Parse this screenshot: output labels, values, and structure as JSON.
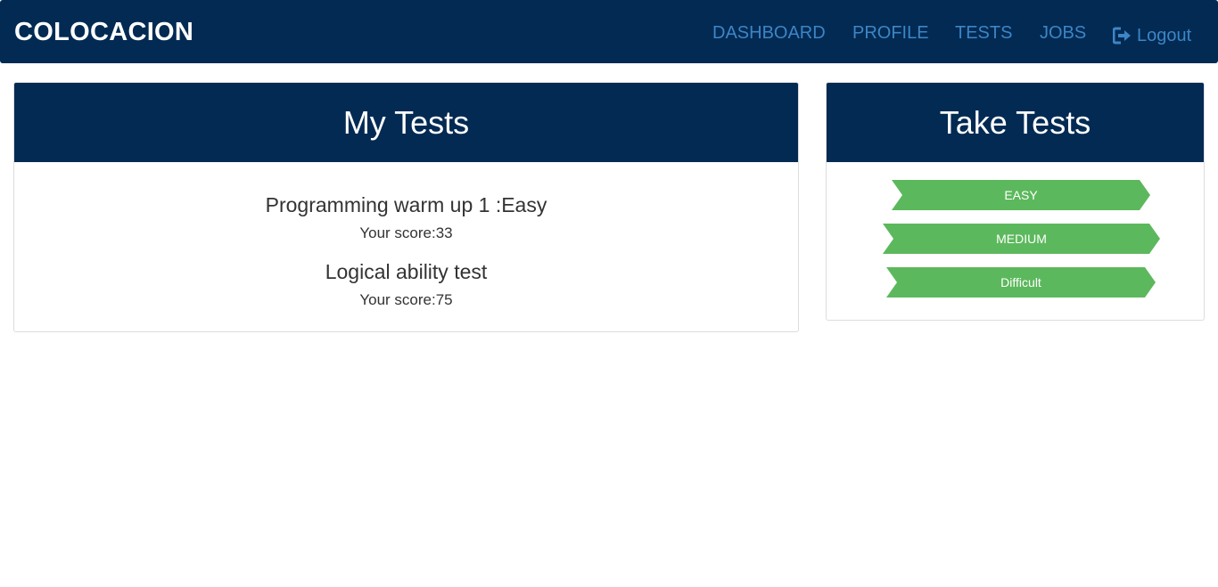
{
  "navbar": {
    "brand": "COLOCACION",
    "links": [
      "DASHBOARD",
      "PROFILE",
      "TESTS",
      "JOBS"
    ],
    "logout": "Logout",
    "logout_icon": "logout-icon"
  },
  "my_tests": {
    "heading": "My Tests",
    "tests": [
      {
        "title": "Programming warm up 1 :Easy",
        "score": "Your score:33"
      },
      {
        "title": "Logical ability test",
        "score": "Your score:75"
      }
    ]
  },
  "take_tests": {
    "heading": "Take Tests",
    "buttons": [
      "EASY",
      "MEDIUM",
      "Difficult"
    ]
  },
  "colors": {
    "navbar_bg": "#022a53",
    "link": "#3d85c6",
    "button": "#5cb85c"
  }
}
